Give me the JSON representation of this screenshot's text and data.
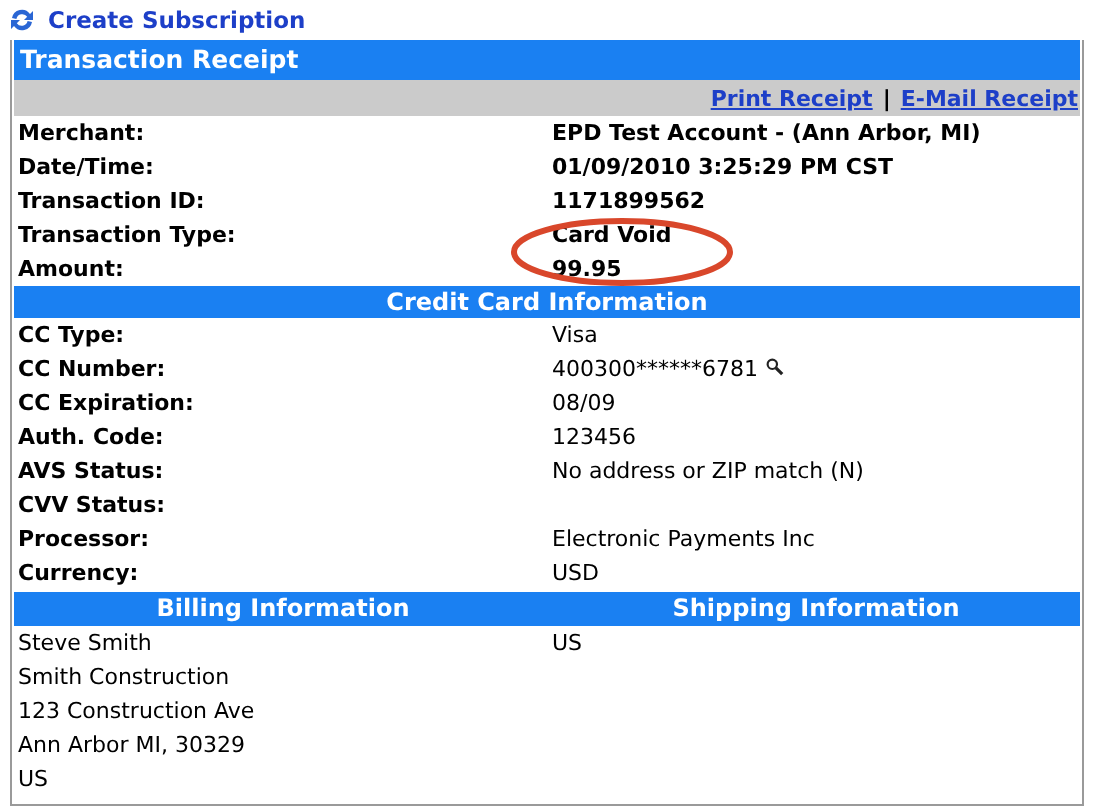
{
  "top_link": {
    "label": "Create Subscription"
  },
  "receipt": {
    "title": "Transaction Receipt",
    "actions": [
      "Print Receipt",
      "E-Mail Receipt"
    ],
    "separator": "|",
    "summary": [
      {
        "label": "Merchant:",
        "value": "EPD Test Account - (Ann Arbor, MI)"
      },
      {
        "label": "Date/Time:",
        "value": "01/09/2010 3:25:29 PM CST"
      },
      {
        "label": "Transaction ID:",
        "value": "1171899562"
      },
      {
        "label": "Transaction Type:",
        "value": "Card Void"
      },
      {
        "label": "Amount:",
        "value": "99.95"
      }
    ],
    "annotation": {
      "kind": "ellipse"
    }
  },
  "credit_card": {
    "title": "Credit Card Information",
    "rows": [
      {
        "label": "CC Type:",
        "value": "Visa",
        "lookup": false
      },
      {
        "label": "CC Number:",
        "value": "400300******6781",
        "lookup": true
      },
      {
        "label": "CC Expiration:",
        "value": "08/09",
        "lookup": false
      },
      {
        "label": "Auth. Code:",
        "value": "123456",
        "lookup": false
      },
      {
        "label": "AVS Status:",
        "value": "No address or ZIP match (N)",
        "lookup": false
      },
      {
        "label": "CVV Status:",
        "lookup": false
      },
      {
        "label": "Processor:",
        "value": "Electronic Payments Inc",
        "lookup": false
      },
      {
        "label": "Currency:",
        "value": "USD",
        "lookup": false
      }
    ]
  },
  "billing": {
    "title": "Billing Information",
    "lines": [
      "Steve Smith",
      "Smith Construction",
      "123 Construction Ave",
      "Ann Arbor MI, 30329",
      "US"
    ]
  },
  "shipping": {
    "title": "Shipping Information",
    "lines": [
      "US"
    ]
  }
}
